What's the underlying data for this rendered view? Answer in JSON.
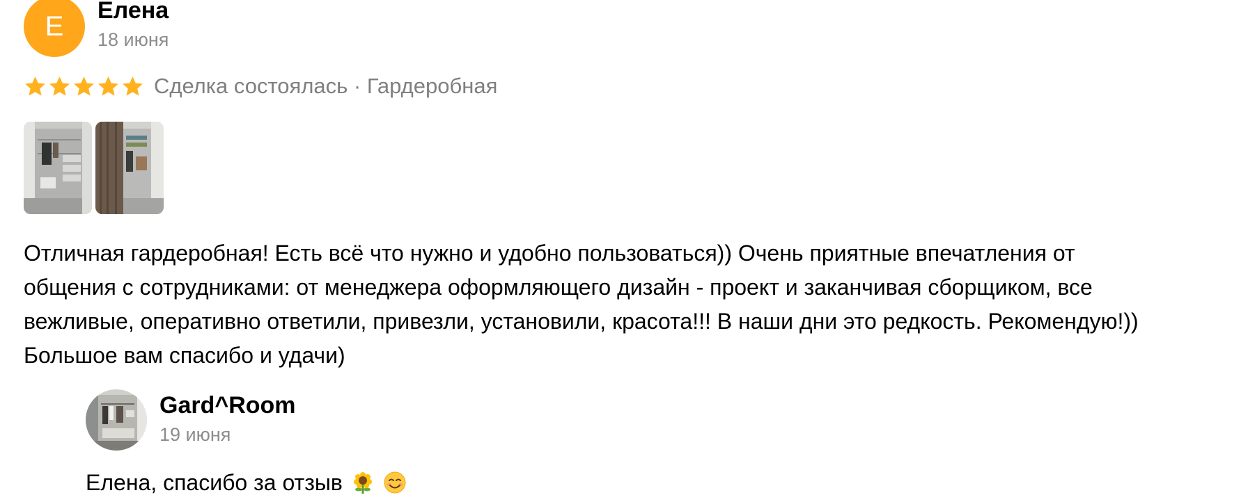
{
  "review": {
    "author": {
      "initial": "Е",
      "name": "Елена",
      "date": "18 июня",
      "avatar_color": "#ffa61a"
    },
    "rating": 5,
    "star_color": "#ffb21e",
    "meta": "Сделка состоялась · Гардеробная",
    "photos": [
      "wardrobe-photo-1",
      "wardrobe-photo-2"
    ],
    "text": "Отличная гардеробная! Есть всё что нужно и удобно пользоваться)) Очень приятные впечатления от общения с сотрудниками: от менеджера оформляющего дизайн - проект и заканчивая сборщиком, все вежливые, оперативно ответили, привезли, установили, красота!!! В наши дни это редкость. Рекомендую!)) Большое вам спасибо и удачи)"
  },
  "reply": {
    "name": "Gard^Room",
    "date": "19 июня",
    "text": "Елена, спасибо за отзыв",
    "emojis": [
      "sunflower-emoji",
      "smiling-face-emoji"
    ]
  }
}
